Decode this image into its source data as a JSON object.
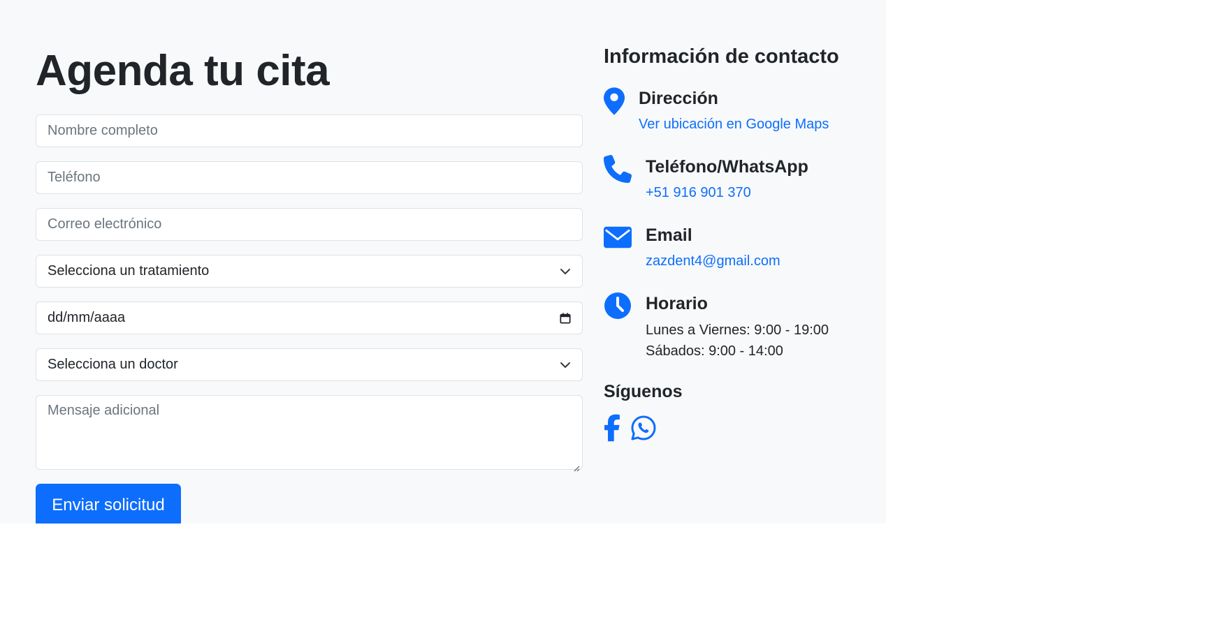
{
  "form": {
    "title": "Agenda tu cita",
    "name_placeholder": "Nombre completo",
    "phone_placeholder": "Teléfono",
    "email_placeholder": "Correo electrónico",
    "treatment_selected": "Selecciona un tratamiento",
    "date_placeholder": "dd/mm/aaaa",
    "doctor_selected": "Selecciona un doctor",
    "message_placeholder": "Mensaje adicional",
    "submit_label": "Enviar solicitud"
  },
  "contact": {
    "title": "Información de contacto",
    "address": {
      "heading": "Dirección",
      "link_text": "Ver ubicación en Google Maps",
      "icon": "map-pin-icon"
    },
    "phone": {
      "heading": "Teléfono/WhatsApp",
      "value": "+51 916 901 370",
      "icon": "phone-icon"
    },
    "email": {
      "heading": "Email",
      "value": "zazdent4@gmail.com",
      "icon": "envelope-icon"
    },
    "hours": {
      "heading": "Horario",
      "weekdays": "Lunes a Viernes: 9:00 - 19:00",
      "saturday": "Sábados: 9:00 - 14:00",
      "icon": "clock-icon"
    },
    "social": {
      "title": "Síguenos",
      "icons": [
        "facebook-icon",
        "whatsapp-icon"
      ]
    }
  },
  "colors": {
    "accent": "#0d6efd",
    "section_bg": "#f8f9fa",
    "text": "#212529",
    "border": "#dee2e6"
  }
}
